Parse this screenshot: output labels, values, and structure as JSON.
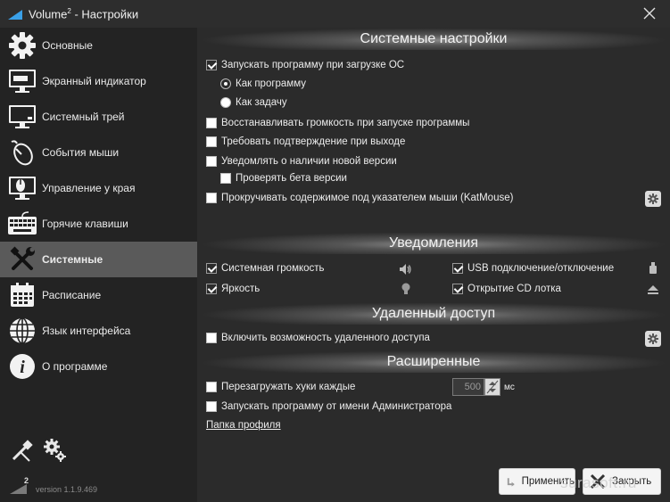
{
  "window": {
    "title": "Volume² - Настройки",
    "title_base": "Volume",
    "title_sup": "2",
    "title_rest": " - Настройки"
  },
  "sidebar": {
    "items": [
      {
        "label": "Основные",
        "icon": "gear-icon"
      },
      {
        "label": "Экранный индикатор",
        "icon": "monitor-indicator-icon"
      },
      {
        "label": "Системный трей",
        "icon": "monitor-tray-icon"
      },
      {
        "label": "События мыши",
        "icon": "mouse-icon"
      },
      {
        "label": "Управление у края",
        "icon": "screen-edge-icon"
      },
      {
        "label": "Горячие клавиши",
        "icon": "keyboard-icon"
      },
      {
        "label": "Системные",
        "icon": "tools-icon",
        "active": true
      },
      {
        "label": "Расписание",
        "icon": "calendar-icon"
      },
      {
        "label": "Язык интерфейса",
        "icon": "globe-icon"
      },
      {
        "label": "О программе",
        "icon": "info-icon"
      }
    ],
    "version_mark": "2",
    "version": "version 1.1.9.469"
  },
  "system": {
    "title": "Системные настройки",
    "autostart": {
      "label": "Запускать программу при загрузке ОС",
      "checked": true
    },
    "as_program": {
      "label": "Как программу",
      "selected": true
    },
    "as_task": {
      "label": "Как задачу",
      "selected": false
    },
    "restore_volume": {
      "label": "Восстанавливать громкость при запуске программы",
      "checked": false
    },
    "confirm_exit": {
      "label": "Требовать подтверждение при выходе",
      "checked": false
    },
    "notify_update": {
      "label": "Уведомлять о наличии новой версии",
      "checked": false
    },
    "check_beta": {
      "label": "Проверять бета версии",
      "checked": false
    },
    "katmouse": {
      "label": "Прокручивать содержимое под указателем мыши (KatMouse)",
      "checked": false
    }
  },
  "notifications": {
    "title": "Уведомления",
    "system_volume": {
      "label": "Системная громкость",
      "checked": true
    },
    "brightness": {
      "label": "Яркость",
      "checked": true
    },
    "usb": {
      "label": "USB подключение/отключение",
      "checked": true
    },
    "cd_tray": {
      "label": "Открытие CD лотка",
      "checked": true
    }
  },
  "remote": {
    "title": "Удаленный доступ",
    "enable": {
      "label": "Включить возможность удаленного доступа",
      "checked": false
    }
  },
  "advanced": {
    "title": "Расширенные",
    "reload_hooks": {
      "label": "Перезагружать хуки каждые",
      "checked": false
    },
    "interval_value": "500",
    "interval_unit": "мс",
    "run_as_admin": {
      "label": "Запускать программу от имени Администратора",
      "checked": false
    },
    "profile_folder": "Папка профиля"
  },
  "buttons": {
    "apply": "Применить",
    "close": "Закрыть"
  },
  "watermark": "surasoft.ru",
  "colors": {
    "background": "#2b2b2b",
    "sidebar": "#232323",
    "active_item": "#5a5a5a",
    "text": "#e8e8e8"
  }
}
